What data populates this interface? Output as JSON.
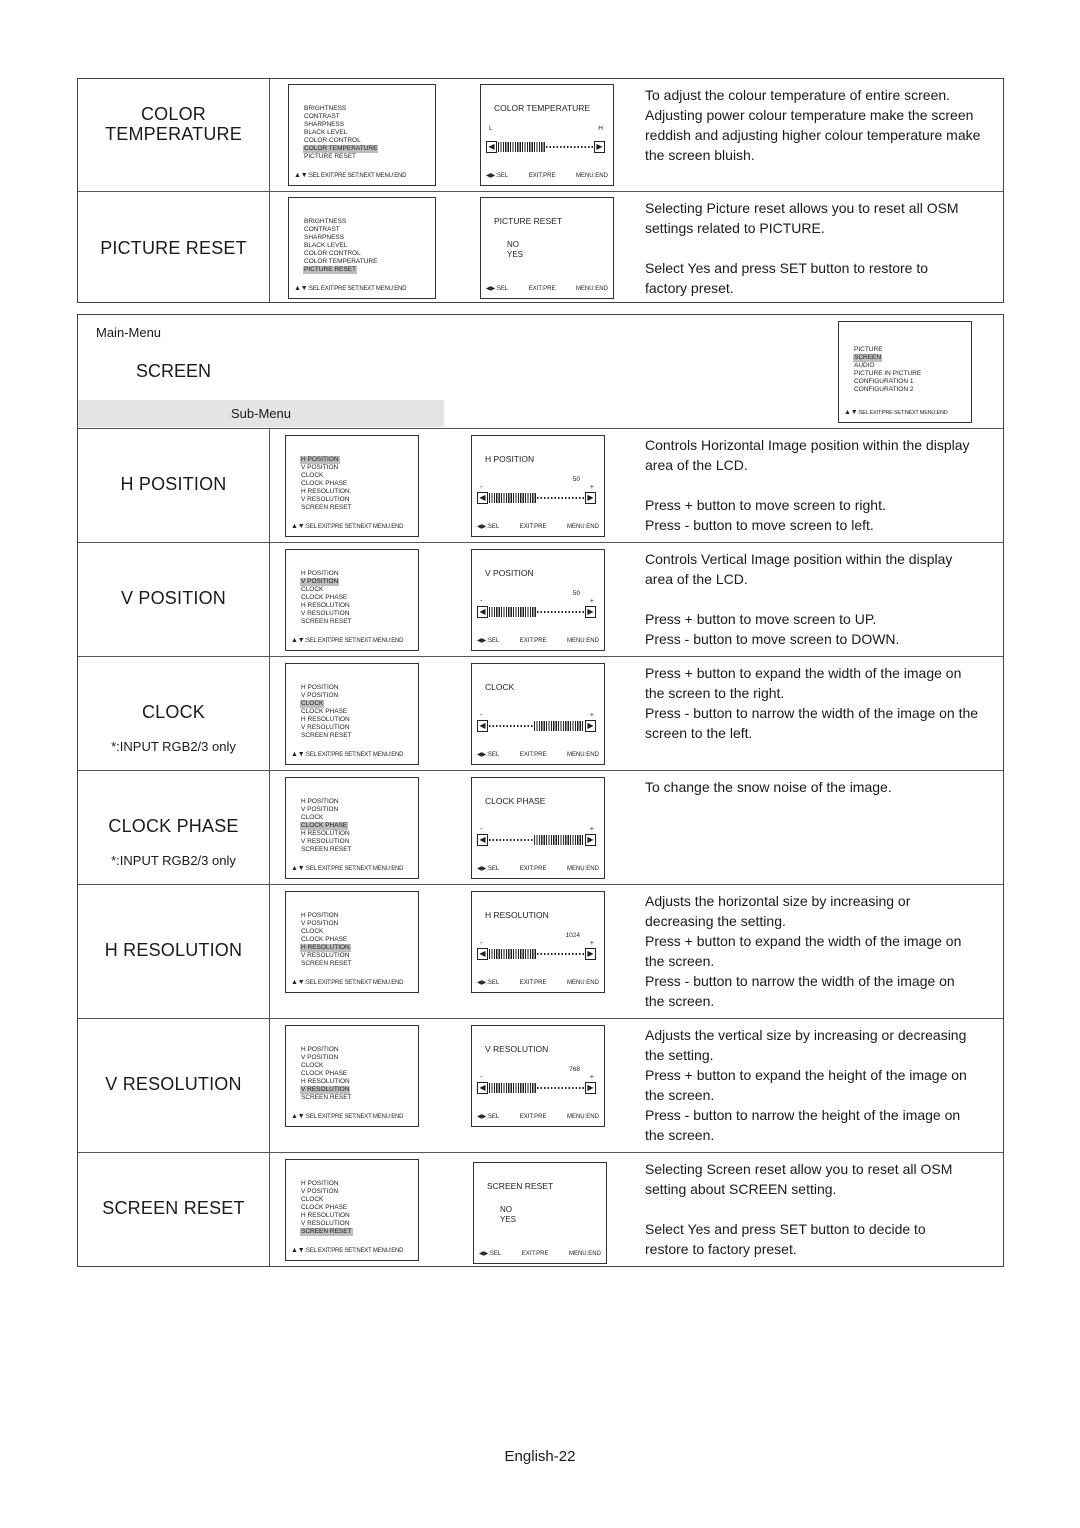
{
  "picture_section": {
    "rows": [
      {
        "title_lines": [
          "COLOR",
          "TEMPERATURE"
        ],
        "menu": {
          "items": [
            "BRIGHTNESS",
            "CONTRAST",
            "SHARPNESS",
            "BLACK LEVEL",
            "COLOR CONTROL",
            "COLOR TEMPERATURE",
            "PICTURE RESET"
          ],
          "selected_index": 5,
          "footer": ":SEL EXIT:PRE SET:NEXT MENU:END"
        },
        "adjust": {
          "title": "COLOR TEMPERATURE",
          "left_label": "L",
          "right_label": "H",
          "fill_fraction": 0.5,
          "fill_from": "left",
          "footer": [
            ":SEL",
            "EXIT:PRE",
            "MENU:END"
          ]
        },
        "description": [
          "To adjust the colour temperature of entire screen.",
          "Adjusting power colour temperature make the screen",
          "reddish and adjusting higher colour temperature make",
          "the screen bluish."
        ]
      },
      {
        "title_lines": [
          "PICTURE RESET"
        ],
        "menu": {
          "items": [
            "BRIGHTNESS",
            "CONTRAST",
            "SHARPNESS",
            "BLACK LEVEL",
            "COLOR CONTROL",
            "COLOR TEMPERATURE",
            "PICTURE RESET"
          ],
          "selected_index": 6,
          "footer": ":SEL EXIT:PRE SET:NEXT MENU:END"
        },
        "reset": {
          "title": "PICTURE RESET",
          "options": [
            "NO",
            "YES"
          ],
          "footer": [
            ":SEL",
            "EXIT:PRE",
            "MENU:END"
          ]
        },
        "description": [
          "Selecting Picture reset allows you to reset all OSM",
          "settings related to PICTURE.",
          "",
          "Select  Yes  and press  SET  button to restore to",
          "factory preset."
        ]
      }
    ]
  },
  "screen_section": {
    "main_menu_label": "Main-Menu",
    "main_menu_title": "SCREEN",
    "sub_menu_label": "Sub-Menu",
    "main_osd": {
      "items": [
        "PICTURE",
        "SCREEN",
        "AUDIO",
        "PICTURE IN PICTURE",
        "CONFIGURATION 1",
        "CONFIGURATION 2"
      ],
      "selected_index": 1,
      "footer": ":SEL EXIT:PRE SET:NEXT MENU:END"
    },
    "sub_items": [
      "H POSITION",
      "V POSITION",
      "CLOCK",
      "CLOCK PHASE",
      "H RESOLUTION",
      "V RESOLUTION",
      "SCREEN RESET"
    ],
    "rows": [
      {
        "title": "H POSITION",
        "note": "",
        "selected_index": 0,
        "adjust": {
          "title": "H POSITION",
          "value": "50",
          "fill_fraction": 0.5,
          "fill_from": "left"
        },
        "description": [
          "Controls Horizontal Image position within the display",
          "area of the LCD.",
          "",
          "Press + button to move screen to right.",
          "Press - button to move screen to left."
        ]
      },
      {
        "title": "V POSITION",
        "note": "",
        "selected_index": 1,
        "adjust": {
          "title": "V POSITION",
          "value": "50",
          "fill_fraction": 0.5,
          "fill_from": "left"
        },
        "description": [
          "Controls Vertical Image position within the display",
          "area of the LCD.",
          "",
          "Press + button to move screen to UP.",
          "Press - button to move screen to DOWN."
        ]
      },
      {
        "title": "CLOCK",
        "note": "*:INPUT RGB2/3 only",
        "selected_index": 2,
        "adjust": {
          "title": "CLOCK",
          "value": "",
          "fill_fraction": 0.5,
          "fill_from": "right"
        },
        "description": [
          "Press + button to expand the width of the image on",
          "the screen to the right.",
          "Press - button to narrow the width of the image on the",
          "screen to the left."
        ]
      },
      {
        "title": "CLOCK PHASE",
        "note": "*:INPUT RGB2/3 only",
        "selected_index": 3,
        "adjust": {
          "title": "CLOCK PHASE",
          "value": "",
          "fill_fraction": 0.5,
          "fill_from": "right"
        },
        "description": [
          "To change the snow noise of the image."
        ]
      },
      {
        "title": "H RESOLUTION",
        "note": "",
        "selected_index": 4,
        "adjust": {
          "title": "H RESOLUTION",
          "value": "1024",
          "fill_fraction": 0.5,
          "fill_from": "left"
        },
        "description": [
          "Adjusts the horizontal size by increasing or",
          "decreasing the setting.",
          "Press + button to expand the width of the image on",
          "the screen.",
          "Press - button to narrow the width of the image on",
          "the screen."
        ]
      },
      {
        "title": "V RESOLUTION",
        "note": "",
        "selected_index": 5,
        "adjust": {
          "title": "V RESOLUTION",
          "value": "768",
          "fill_fraction": 0.5,
          "fill_from": "left"
        },
        "description": [
          "Adjusts the vertical size by increasing or decreasing",
          "the setting.",
          "Press + button to expand the height of the image on",
          "the screen.",
          "Press - button to narrow the height of the image on",
          "the screen."
        ]
      },
      {
        "title": "SCREEN RESET",
        "note": "",
        "selected_index": 6,
        "reset": {
          "title": "SCREEN RESET",
          "options": [
            "NO",
            "YES"
          ]
        },
        "description": [
          "Selecting Screen reset allow you to reset all OSM",
          "setting about SCREEN setting.",
          "",
          "Select  Yes  and press  SET  button to decide to",
          "restore to factory preset."
        ]
      }
    ],
    "menu_footer": ":SEL EXIT:PRE SET:NEXT MENU:END",
    "adjust_footer": [
      ":SEL",
      "EXIT:PRE",
      "MENU:END"
    ],
    "minus_label": "-",
    "plus_label": "+"
  },
  "footer": {
    "page_label": "English-22"
  }
}
